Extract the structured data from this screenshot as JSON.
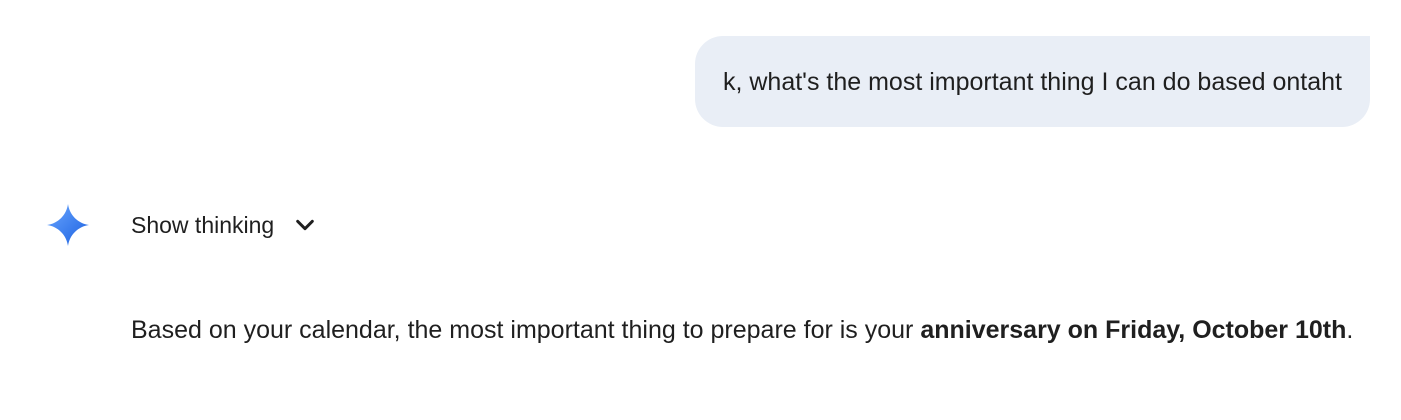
{
  "user_message": {
    "text": "k, what's the most important thing I can do based ontaht"
  },
  "assistant": {
    "icon": "sparkle-icon",
    "show_thinking_label": "Show thinking",
    "response": {
      "part1": "Based on your calendar, the most important thing to prepare for is your ",
      "bold": "anniversary on Friday, October 10th",
      "part2": "."
    }
  },
  "colors": {
    "user_bubble_bg": "#e9eef6",
    "text": "#1f1f1f",
    "sparkle_gradient_start": "#4f8cf7",
    "sparkle_gradient_end": "#1a6ae8"
  }
}
